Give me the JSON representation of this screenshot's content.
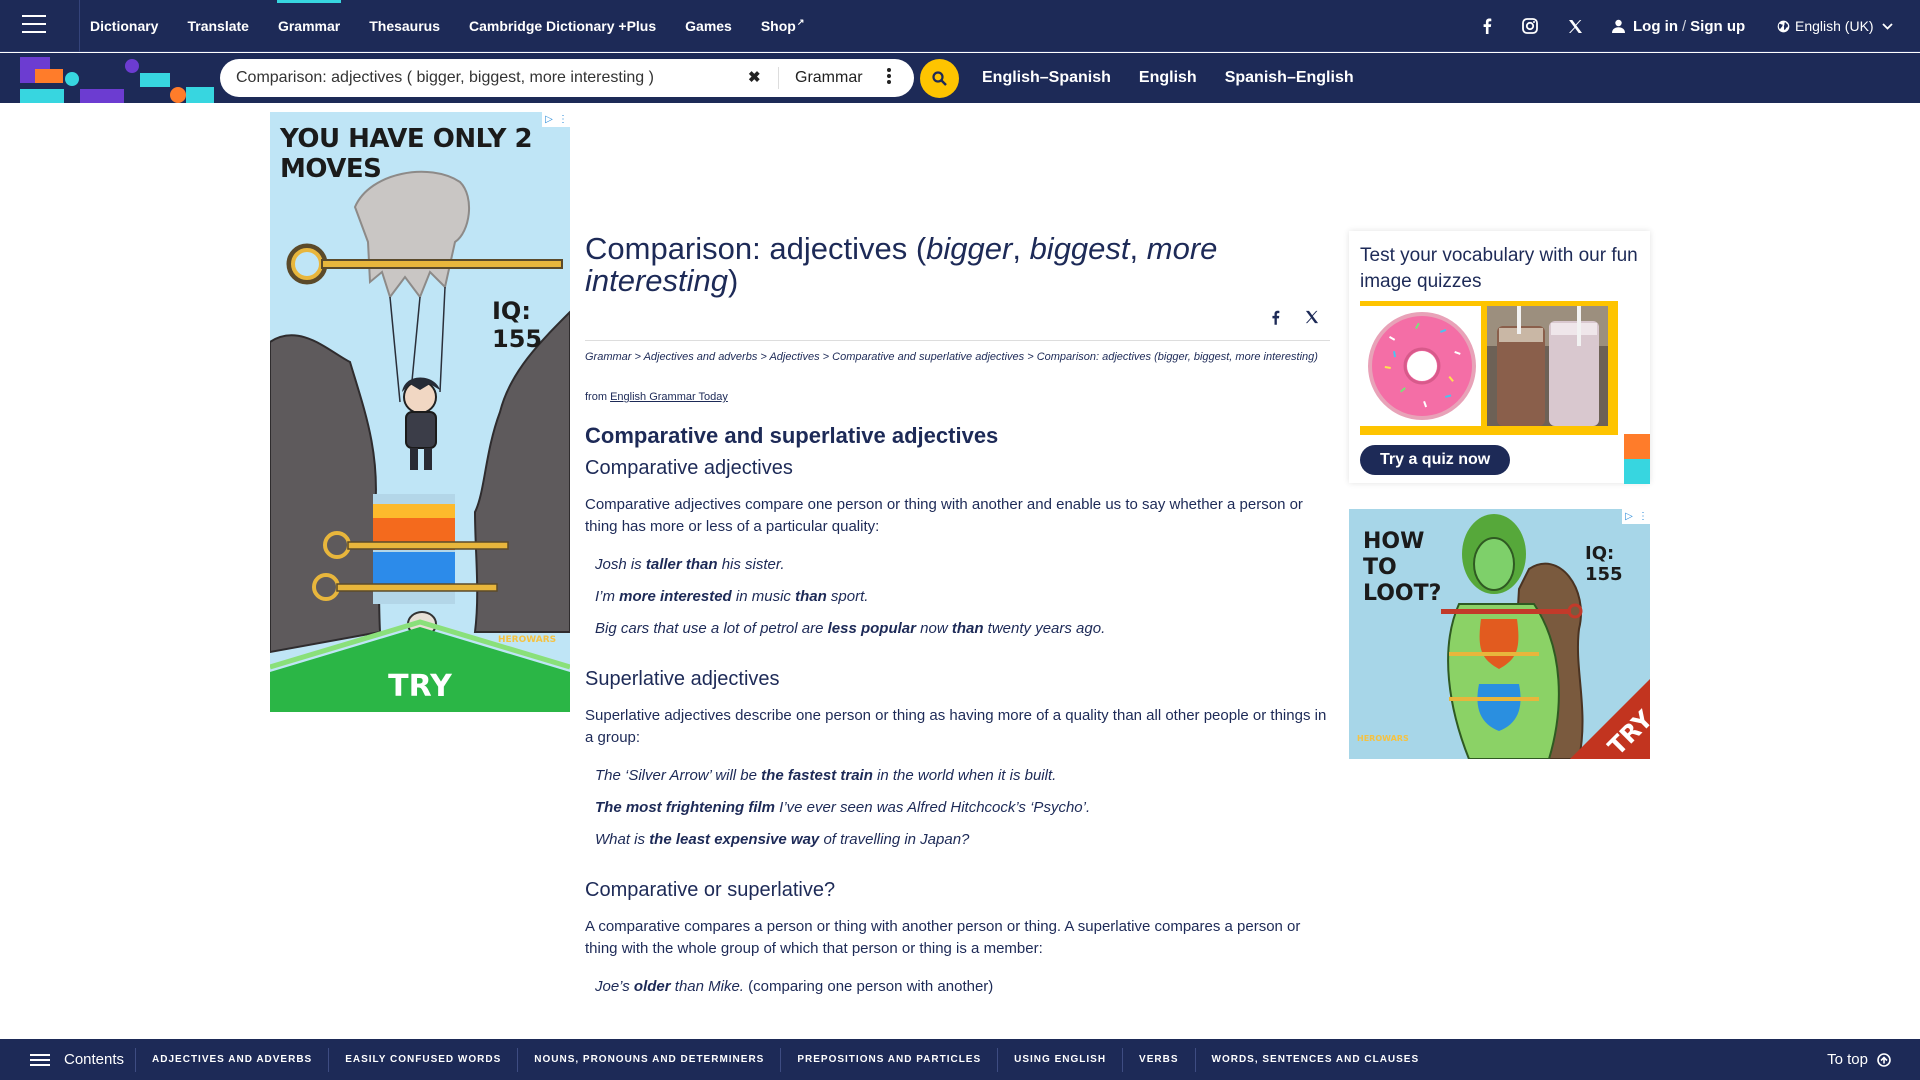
{
  "nav": {
    "items": [
      {
        "label": "Dictionary",
        "active": false
      },
      {
        "label": "Translate",
        "active": false
      },
      {
        "label": "Grammar",
        "active": true
      },
      {
        "label": "Thesaurus",
        "active": false
      },
      {
        "label": "Cambridge Dictionary +Plus",
        "active": false
      },
      {
        "label": "Games",
        "active": false
      },
      {
        "label": "Shop",
        "active": false
      }
    ],
    "login": "Log in",
    "signup": "Sign up",
    "login_separator": "/",
    "language": "English (UK)"
  },
  "search": {
    "query": "Comparison: adjectives ( bigger, biggest, more interesting )",
    "dictionary": "Grammar",
    "tabs": [
      "English–Spanish",
      "English",
      "Spanish–English"
    ]
  },
  "ad_left": {
    "headline": "YOU HAVE ONLY 2 MOVES",
    "iq": "IQ: 155",
    "brand": "HEROWARS",
    "cta": "TRY"
  },
  "article": {
    "title_prefix": "Comparison: adjectives (",
    "title_em1": "bigger",
    "title_sep1": ", ",
    "title_em2": "biggest",
    "title_sep2": ", ",
    "title_em3": "more interesting",
    "title_suffix": ")",
    "breadcrumb": [
      "Grammar",
      "Adjectives and adverbs",
      "Adjectives",
      "Comparative and superlative adjectives",
      "Comparison: adjectives (bigger, biggest, more interesting)"
    ],
    "breadcrumb_separator": " > ",
    "source_prefix": "from",
    "source_link": "English Grammar Today",
    "heading_main": "Comparative and superlative adjectives",
    "sections": [
      {
        "heading": "Comparative adjectives",
        "text": "Comparative adjectives compare one person or thing with another and enable us to say whether a person or thing has more or less of a particular quality:",
        "examples": [
          [
            {
              "t": "Josh is "
            },
            {
              "b": "taller than"
            },
            {
              "t": " his sister."
            }
          ],
          [
            {
              "t": "I’m "
            },
            {
              "b": "more interested"
            },
            {
              "t": " in music "
            },
            {
              "b": "than"
            },
            {
              "t": " sport."
            }
          ],
          [
            {
              "t": "Big cars that use a lot of petrol are "
            },
            {
              "b": "less popular"
            },
            {
              "t": " now "
            },
            {
              "b": "than"
            },
            {
              "t": " twenty years ago."
            }
          ]
        ]
      },
      {
        "heading": "Superlative adjectives",
        "text": "Superlative adjectives describe one person or thing as having more of a quality than all other people or things in a group:",
        "examples": [
          [
            {
              "t": "The ‘Silver Arrow’ will be "
            },
            {
              "b": "the fastest train"
            },
            {
              "t": " in the world when it is built."
            }
          ],
          [
            {
              "b": "The most frightening film"
            },
            {
              "t": " I’ve ever seen was Alfred Hitchcock’s ‘Psycho’."
            }
          ],
          [
            {
              "t": "What is "
            },
            {
              "b": "the least expensive way"
            },
            {
              "t": " of travelling in Japan?"
            }
          ]
        ]
      },
      {
        "heading": "Comparative or superlative?",
        "text": "A comparative compares a person or thing with another person or thing. A superlative compares a person or thing with the whole group of which that person or thing is a member:",
        "examples": [
          [
            {
              "t": "Joe’s "
            },
            {
              "b": "older"
            },
            {
              "t": " than Mike."
            },
            {
              "p": " (comparing one person with another)"
            }
          ]
        ]
      }
    ]
  },
  "quiz": {
    "title": "Test your vocabulary with our fun image quizzes",
    "button": "Try a quiz now"
  },
  "ad_right": {
    "headline": "HOW TO LOOT?",
    "iq": "IQ: 155",
    "brand": "HEROWARS",
    "cta": "TRY"
  },
  "bottom": {
    "contents": "Contents",
    "links": [
      "ADJECTIVES AND ADVERBS",
      "EASILY CONFUSED WORDS",
      "NOUNS, PRONOUNS AND DETERMINERS",
      "PREPOSITIONS AND PARTICLES",
      "USING ENGLISH",
      "VERBS",
      "WORDS, SENTENCES AND CLAUSES"
    ],
    "to_top": "To top"
  },
  "colors": {
    "navy": "#1d2a57",
    "accent_yellow": "#fec400",
    "accent_cyan": "#37d6e0",
    "logo_purple": "#6c3cd1",
    "logo_orange": "#ff7c2a"
  }
}
